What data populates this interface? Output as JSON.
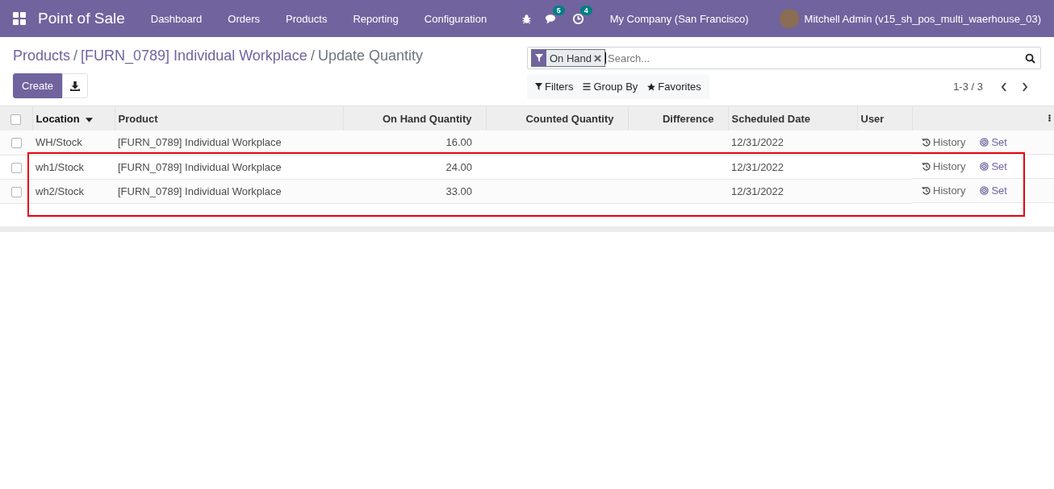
{
  "navbar": {
    "app_title": "Point of Sale",
    "menu": [
      "Dashboard",
      "Orders",
      "Products",
      "Reporting",
      "Configuration"
    ],
    "messages_count": "5",
    "activities_count": "4",
    "company": "My Company (San Francisco)",
    "user": "Mitchell Admin (v15_sh_pos_multi_waerhouse_03)"
  },
  "breadcrumbs": [
    {
      "label": "Products",
      "kind": "link"
    },
    {
      "label": "[FURN_0789] Individual Workplace",
      "kind": "link",
      "separator_before": "/"
    },
    {
      "label": "Update Quantity",
      "kind": "current",
      "separator_before": "/"
    }
  ],
  "buttons": {
    "create": "Create"
  },
  "search": {
    "facet": "On Hand",
    "placeholder": "Search..."
  },
  "search_options": [
    "Filters",
    "Group By",
    "Favorites"
  ],
  "pager": "1-3 / 3",
  "table": {
    "all_selected": false,
    "columns": [
      {
        "label": "Location",
        "kind": "text",
        "sorted": true
      },
      {
        "label": "Product",
        "kind": "text",
        "sorted": false
      },
      {
        "label": "On Hand Quantity",
        "kind": "number",
        "sorted": false
      },
      {
        "label": "Counted Quantity",
        "kind": "number",
        "sorted": false
      },
      {
        "label": "Difference",
        "kind": "number",
        "sorted": false
      },
      {
        "label": "Scheduled Date",
        "kind": "text",
        "sorted": false
      },
      {
        "label": "User",
        "kind": "text",
        "sorted": false
      }
    ],
    "rows": [
      {
        "checked": false,
        "cells": [
          "WH/Stock",
          "[FURN_0789] Individual Workplace",
          "16.00",
          "",
          "",
          "12/31/2022",
          ""
        ],
        "history": "History",
        "set": "Set"
      },
      {
        "checked": false,
        "cells": [
          "wh1/Stock",
          "[FURN_0789] Individual Workplace",
          "24.00",
          "",
          "",
          "12/31/2022",
          ""
        ],
        "history": "History",
        "set": "Set"
      },
      {
        "checked": false,
        "cells": [
          "wh2/Stock",
          "[FURN_0789] Individual Workplace",
          "33.00",
          "",
          "",
          "12/31/2022",
          ""
        ],
        "history": "History",
        "set": "Set"
      }
    ]
  }
}
